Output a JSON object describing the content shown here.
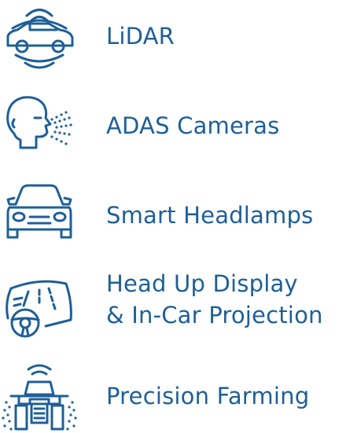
{
  "colors": {
    "icon": "#1e5f98",
    "text": "#1e5f98",
    "background": "#ffffff"
  },
  "items": [
    {
      "icon": "car-sensing-waves-icon",
      "lines": [
        "LiDAR"
      ]
    },
    {
      "icon": "face-camera-beam-icon",
      "lines": [
        "ADAS Cameras"
      ]
    },
    {
      "icon": "car-front-headlamps-icon",
      "lines": [
        "Smart Headlamps"
      ]
    },
    {
      "icon": "windshield-steering-wheel-icon",
      "lines": [
        "Head Up Display",
        "& In-Car Projection"
      ]
    },
    {
      "icon": "tractor-sprayer-icon",
      "lines": [
        "Precision Farming"
      ]
    }
  ]
}
